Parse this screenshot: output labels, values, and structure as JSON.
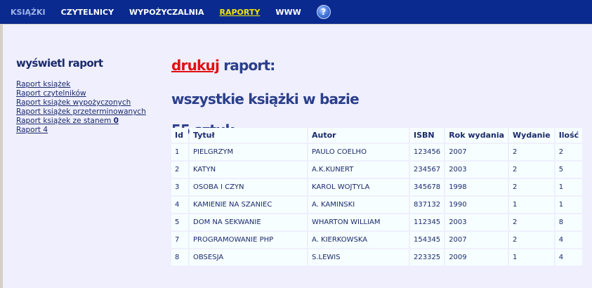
{
  "nav": {
    "items": [
      "KSIĄŻKI",
      "CZYTELNICY",
      "WYPOŻYCZALNIA",
      "RAPORTY",
      "WWW"
    ],
    "help_label": "?"
  },
  "sidebar": {
    "title": "wyświetl raport",
    "links": [
      "Raport książek",
      "Raport czytelników",
      "Raport książek wypożyczonych",
      "Raport książek przeterminowanych",
      "Raport książek ze stanem",
      "Raport 4"
    ],
    "stock_value": "0"
  },
  "report": {
    "print_link": "drukuj",
    "heading_suffix": "raport:",
    "subtitle": "wszystkie książki w bazie",
    "count_label": "55 sztuk"
  },
  "table": {
    "columns": [
      "Id",
      "Tytuł",
      "Autor",
      "ISBN",
      "Rok wydania",
      "Wydanie",
      "Ilość"
    ],
    "rows": [
      [
        "1",
        "PIELGRZYM",
        "PAULO COELHO",
        "123456",
        "2007",
        "2",
        "2"
      ],
      [
        "2",
        "KATYN",
        "A.K.KUNERT",
        "234567",
        "2003",
        "2",
        "5"
      ],
      [
        "3",
        "OSOBA I CZYN",
        "KAROL WOJTYLA",
        "345678",
        "1998",
        "2",
        "1"
      ],
      [
        "4",
        "KAMIENIE NA SZANIEC",
        "A. KAMINSKI",
        "837132",
        "1990",
        "1",
        "1"
      ],
      [
        "5",
        "DOM NA SEKWANIE",
        "WHARTON WILLIAM",
        "112345",
        "2003",
        "2",
        "8"
      ],
      [
        "7",
        "PROGRAMOWANIE PHP",
        "A. KIERKOWSKA",
        "154345",
        "2007",
        "2",
        "4"
      ],
      [
        "8",
        "OBSESJA",
        "S.LEWIS",
        "223325",
        "2009",
        "1",
        "4"
      ]
    ]
  }
}
